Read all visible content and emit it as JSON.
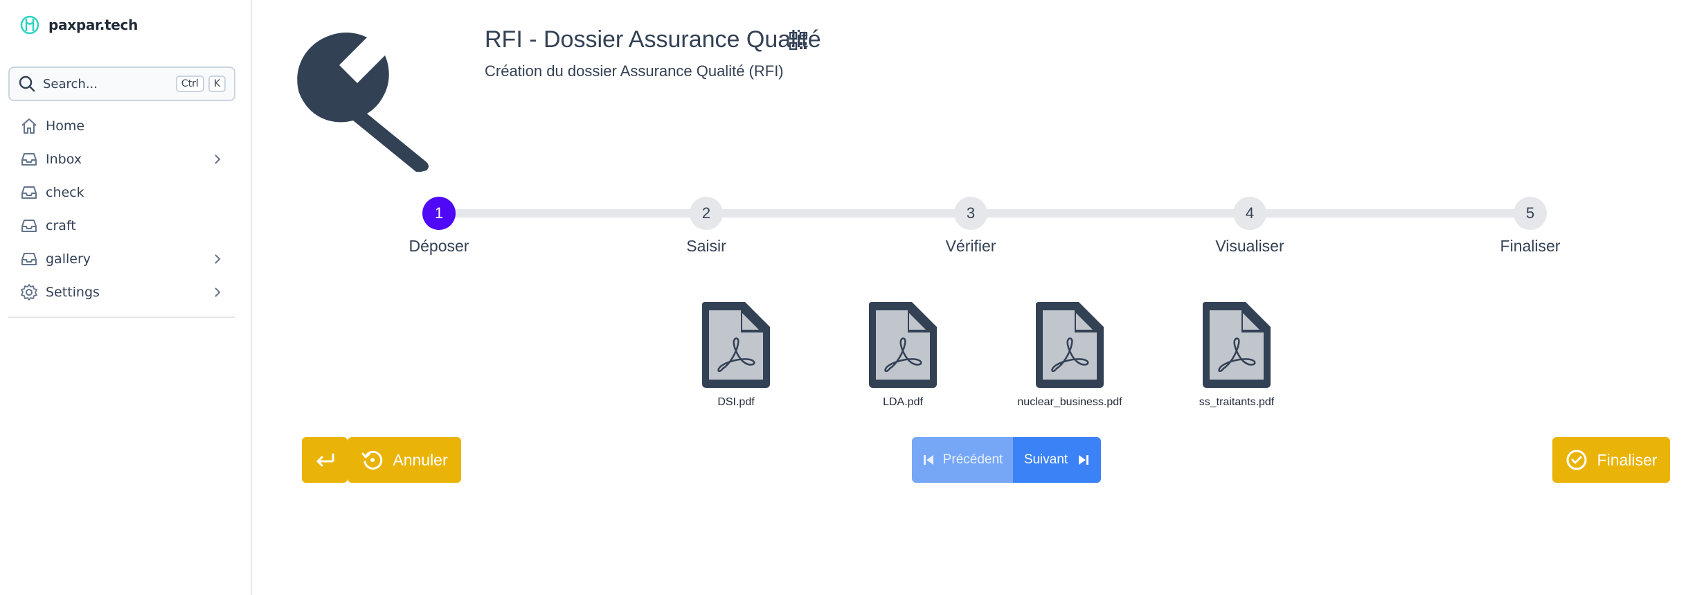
{
  "sidebar": {
    "brand": "paxpar.tech",
    "search": {
      "placeholder": "Search...",
      "kbd1": "Ctrl",
      "kbd2": "K"
    },
    "items": [
      {
        "label": "Home",
        "icon": "home-icon",
        "has_children": false
      },
      {
        "label": "Inbox",
        "icon": "inbox-icon",
        "has_children": true
      },
      {
        "label": "check",
        "icon": "inbox-icon",
        "has_children": false
      },
      {
        "label": "craft",
        "icon": "inbox-icon",
        "has_children": false
      },
      {
        "label": "gallery",
        "icon": "inbox-icon",
        "has_children": true
      },
      {
        "label": "Settings",
        "icon": "gear-icon",
        "has_children": true
      }
    ]
  },
  "header": {
    "title": "RFI - Dossier Assurance Qualité",
    "subtitle": "Création du dossier Assurance Qualité (RFI)"
  },
  "stepper": {
    "active": 1,
    "steps": [
      {
        "number": "1",
        "label": "Déposer"
      },
      {
        "number": "2",
        "label": "Saisir"
      },
      {
        "number": "3",
        "label": "Vérifier"
      },
      {
        "number": "4",
        "label": "Visualiser"
      },
      {
        "number": "5",
        "label": "Finaliser"
      }
    ]
  },
  "files": [
    {
      "name": "DSI.pdf"
    },
    {
      "name": "LDA.pdf"
    },
    {
      "name": "nuclear_business.pdf"
    },
    {
      "name": "ss_traitants.pdf"
    }
  ],
  "actions": {
    "cancel_label": "Annuler",
    "prev_label": "Précédent",
    "next_label": "Suivant",
    "finalize_label": "Finaliser"
  },
  "colors": {
    "accent": "#4f09f6",
    "warning": "#eab308",
    "primary": "#3b82f6",
    "icon_dark": "#334155"
  }
}
